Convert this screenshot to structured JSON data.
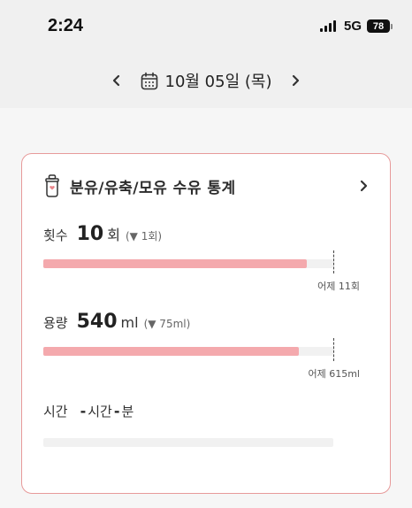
{
  "status_bar": {
    "time": "2:24",
    "network": "5G",
    "battery": "78"
  },
  "date_nav": {
    "date_text": "10월 05일 (목)"
  },
  "card": {
    "title": "분유/유축/모유 수유 통계",
    "count": {
      "label": "횟수",
      "value": "10",
      "unit": "회",
      "delta": "(▼ 1회)",
      "yesterday": "어제 11회",
      "fill_fraction": 0.91
    },
    "volume": {
      "label": "용량",
      "value": "540",
      "unit": "ml",
      "delta": "(▼ 75ml)",
      "yesterday": "어제 615ml",
      "fill_fraction": 0.88
    },
    "duration": {
      "label": "시간",
      "hours_dash": "-",
      "hours_unit": "시간",
      "minutes_dash": "-",
      "minutes_unit": "분",
      "fill_fraction": 0
    }
  },
  "colors": {
    "accent_border": "#e79a9a",
    "bar_fill": "#f4a9ad",
    "bar_track": "#f1f1f1"
  }
}
